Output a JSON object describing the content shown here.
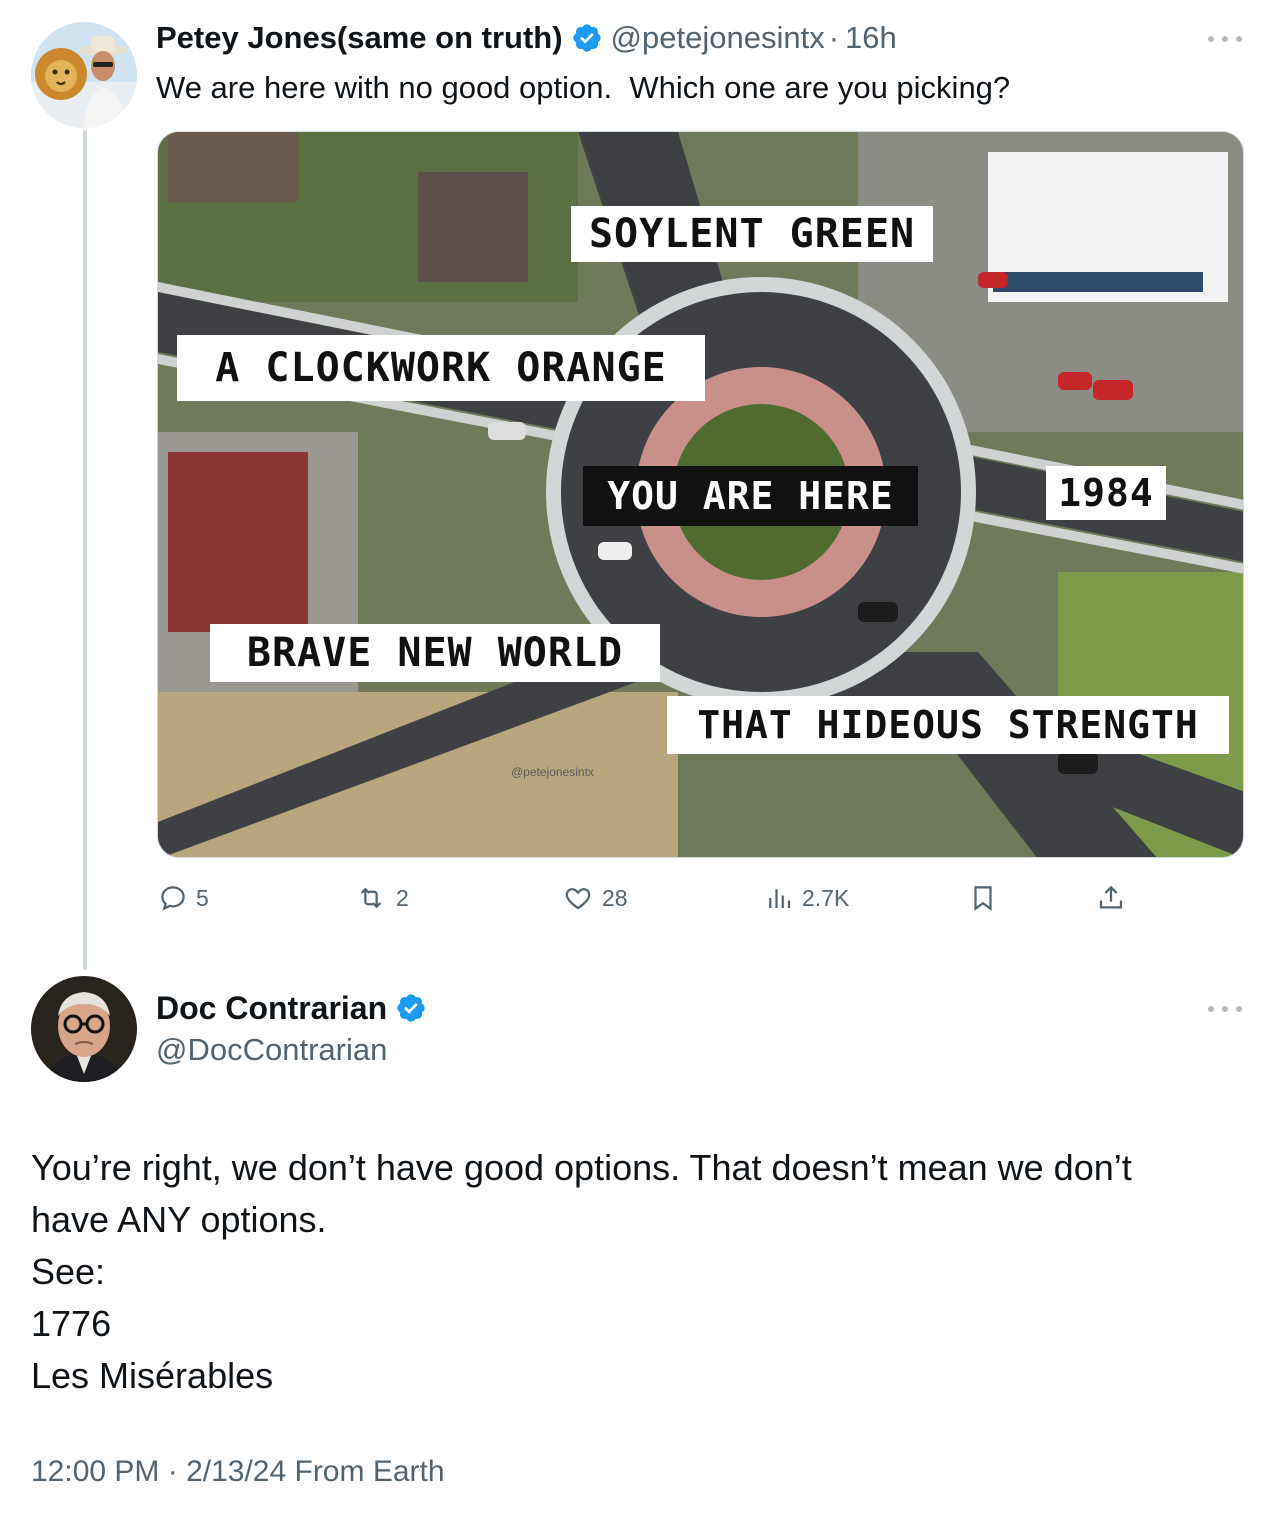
{
  "tweet1": {
    "display_name": "Petey Jones(same on truth)",
    "handle": "@petejonesintx",
    "separator": "·",
    "time": "16h",
    "text": "We are here with no good option.  Which one are you picking?",
    "media": {
      "labels": {
        "soylent": "SOYLENT GREEN",
        "clockwork": "A CLOCKWORK ORANGE",
        "here": "YOU ARE HERE",
        "n1984": "1984",
        "brave": "BRAVE NEW WORLD",
        "hideous": "THAT HIDEOUS STRENGTH"
      },
      "watermark": "@petejonesintx"
    },
    "actions": {
      "replies": "5",
      "reposts": "2",
      "likes": "28",
      "views": "2.7K"
    }
  },
  "tweet2": {
    "display_name": "Doc Contrarian",
    "handle": "@DocContrarian",
    "lines": [
      "You’re right, we don’t have good options. That doesn’t mean we don’t",
      "have ANY options.",
      "See:",
      "1776",
      "Les Misérables"
    ],
    "meta": "12:00 PM · 2/13/24 From Earth"
  },
  "colors": {
    "verified": "#1d9bf0",
    "secondary_text": "#536471",
    "thread_line": "#cfd9de"
  },
  "icons": [
    "verified-badge-icon",
    "more-icon",
    "reply-icon",
    "repost-icon",
    "like-icon",
    "views-icon",
    "bookmark-icon",
    "share-icon"
  ]
}
